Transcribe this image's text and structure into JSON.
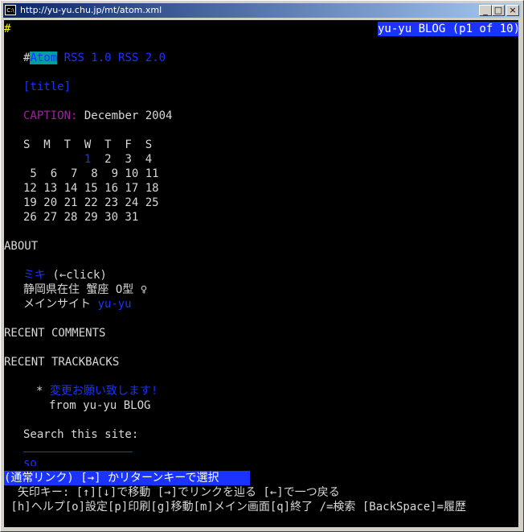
{
  "window": {
    "title": "http://yu-yu.chu.jp/mt/atom.xml",
    "icon": "terminal-icon",
    "buttons": {
      "minimize": "_",
      "maximize": "□",
      "close": "×"
    }
  },
  "terminal": {
    "cursor": "#",
    "header_badge": "yu-yu BLOG (p1 of 10)",
    "feeds": {
      "hash": "#",
      "atom": "Atom",
      "rss1": "RSS 1.0",
      "rss2": "RSS 2.0"
    },
    "title_link": "[title]",
    "caption_label": "CAPTION:",
    "caption_value": "December 2004",
    "calendar": {
      "header": "S  M  T  W  T  F  S",
      "row1_pad": "         ",
      "row1_link": "1",
      "row1_rest": "  2  3  4",
      "rows": [
        " 5  6  7  8  9 10 11",
        "12 13 14 15 16 17 18",
        "19 20 21 22 23 24 25",
        "26 27 28 29 30 31"
      ]
    },
    "about_heading": "ABOUT",
    "about": {
      "name_link": "ミキ",
      "name_suffix": " (←click)",
      "profile": "静岡県在住 蟹座 O型 ♀",
      "site_label": "メインサイト ",
      "site_link": "yu-yu"
    },
    "recent_comments": "RECENT COMMENTS",
    "recent_trackbacks": "RECENT TRACKBACKS",
    "trackback": {
      "bullet": "*",
      "title": "変更お願い致します!",
      "from": "from yu-yu BLOG"
    },
    "search_label": "Search this site:",
    "search_button_partial": "so",
    "status_line": "(通常リンク) [→] かリターンキーで選択",
    "help_line1": "  矢印キー: [↑][↓]で移動 [→]でリンクを辿る [←]で一つ戻る",
    "help_line2": " [h]ヘルプ[o]設定[p]印刷[g]移動[m]メイン画面[q]終了 /=検索 [BackSpace]=履歴"
  }
}
